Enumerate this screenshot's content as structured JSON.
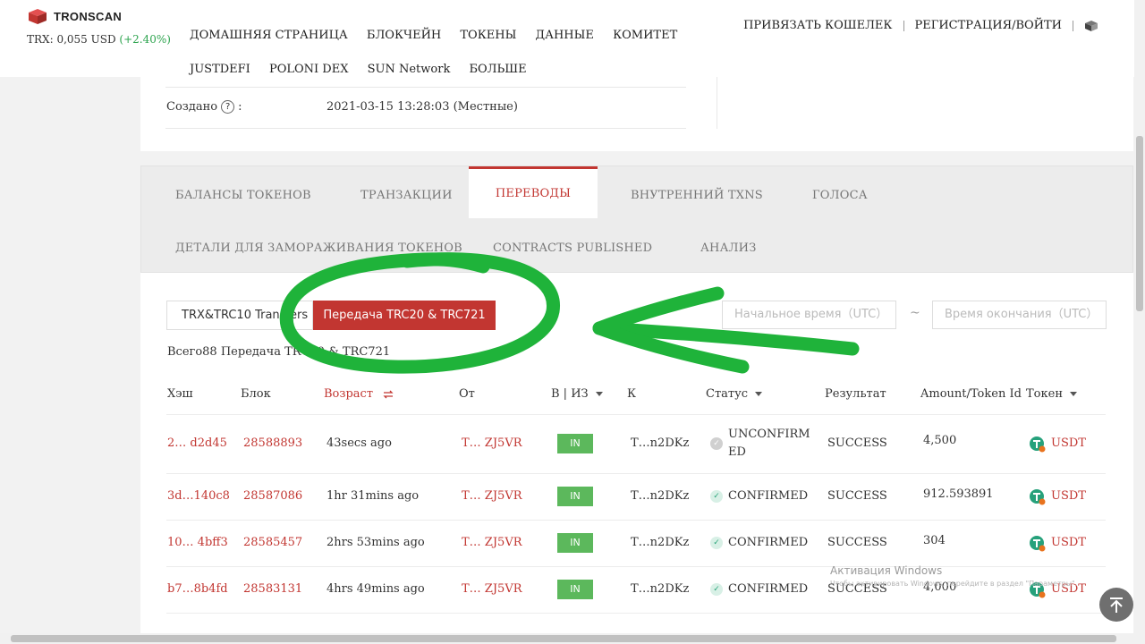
{
  "brand": {
    "name": "TRONSCAN"
  },
  "price": {
    "label": "TRX: 0,055 USD",
    "change": "(+2.40%)"
  },
  "nav": {
    "items": [
      "ДОМАШНЯЯ СТРАНИЦА",
      "БЛОКЧЕЙН",
      "ТОКЕНЫ",
      "ДАННЫЕ",
      "КОМИТЕТ",
      "JUSTDEFI",
      "POLONI DEX",
      "SUN Network",
      "БОЛЬШЕ"
    ],
    "wallet": "ПРИВЯЗАТЬ КОШЕЛЕК",
    "login": "РЕГИСТРАЦИЯ/ВОЙТИ"
  },
  "account": {
    "created_label": "Создано",
    "created_value": "2021-03-15 13:28:03 (Местные)"
  },
  "tabs": {
    "row1": [
      "БАЛАНСЫ ТОКЕНОВ",
      "ТРАНЗАКЦИИ",
      "ПЕРЕВОДЫ",
      "ВНУТРЕННИЙ TXNS",
      "ГОЛОСА"
    ],
    "row2": [
      "ДЕТАЛИ ДЛЯ ЗАМОРАЖИВАНИЯ ТОКЕНОВ",
      "CONTRACTS PUBLISHED",
      "АНАЛИЗ"
    ],
    "active": "ПЕРЕВОДЫ"
  },
  "filters": {
    "btn_trx": "TRX&TRC10 Transfers",
    "btn_trc20": "Передача TRC20 & TRC721",
    "start_placeholder": "Начальное время（UTC）",
    "end_placeholder": "Время окончания（UTC）",
    "tilde": "~"
  },
  "summary": {
    "total_text": "Всего88 Передача TRC20 & TRC721"
  },
  "table": {
    "headers": {
      "hash": "Хэш",
      "block": "Блок",
      "age": "Возраст",
      "from": "От",
      "inout": "В | ИЗ",
      "to": "К",
      "status": "Статус",
      "result": "Результат",
      "amount": "Amount/Token Id",
      "token": "Токен"
    },
    "rows": [
      {
        "hash": "2… d2d45",
        "block": "28588893",
        "age": "43secs ago",
        "from": "T… ZJ5VR",
        "dir": "IN",
        "to": "T…n2DKz",
        "status": "UNCONFIRMED",
        "status_l1": "UNCONFIRM",
        "status_l2": "ED",
        "result": "SUCCESS",
        "amount": "4,500",
        "token": "USDT"
      },
      {
        "hash": "3d…140c8",
        "block": "28587086",
        "age": "1hr 31mins ago",
        "from": "T… ZJ5VR",
        "dir": "IN",
        "to": "T…n2DKz",
        "status": "CONFIRMED",
        "result": "SUCCESS",
        "amount": "912.593891",
        "token": "USDT"
      },
      {
        "hash": "10… 4bff3",
        "block": "28585457",
        "age": "2hrs 53mins ago",
        "from": "T… ZJ5VR",
        "dir": "IN",
        "to": "T…n2DKz",
        "status": "CONFIRMED",
        "result": "SUCCESS",
        "amount": "304",
        "token": "USDT"
      },
      {
        "hash": "b7…8b4fd",
        "block": "28583131",
        "age": "4hrs 49mins ago",
        "from": "T… ZJ5VR",
        "dir": "IN",
        "to": "T…n2DKz",
        "status": "CONFIRMED",
        "result": "SUCCESS",
        "amount": "4,000",
        "token": "USDT"
      }
    ]
  },
  "watermark": {
    "title": "Активация Windows",
    "subtitle": "Чтобы активировать Windows, перейдите в раздел \"Параметры\"."
  },
  "colors": {
    "accent": "#c23631",
    "in_badge": "#5cb85c",
    "annotation": "#1fb33a",
    "tether": "#26a17b"
  }
}
